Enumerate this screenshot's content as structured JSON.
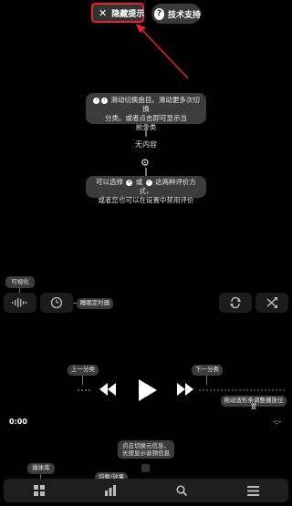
{
  "top": {
    "hide_tips_label": "隐藏提示",
    "support_label": "技术支持"
  },
  "tips": {
    "swipe_line1": "滑动切换曲目。滑动更多次切换",
    "swipe_line2": "分类。或者点击即可显示当",
    "swipe_line3": "前分类",
    "empty": "无内容",
    "rate_part1": "可以选择",
    "rate_or": "或",
    "rate_part2": "这两种评价方式，",
    "rate_line2": "或者您也可以在设置中禁用评价",
    "visualize": "可视化",
    "sleep_timer": "睡眠定时器",
    "prev_category": "上一分类",
    "next_category": "下一分类",
    "drag_waveform": "拖动波形条调整播放位置",
    "info_line1": "点击切换元信息，",
    "info_line2": "长按显示音频信息",
    "library": "媒体库",
    "equalizer": "均衡/效果"
  },
  "player": {
    "current_time": "0:00",
    "end_time": "-:-"
  },
  "icons": {
    "hide": "close-icon",
    "support": "help-icon",
    "settings": "gear-icon",
    "visualizer": "waveform-icon",
    "timer": "clock-icon",
    "repeat": "repeat-icon",
    "shuffle": "shuffle-icon",
    "play": "play-icon",
    "rewind": "rewind-icon",
    "fast_forward": "fast-forward-icon",
    "library": "grid-icon",
    "eq": "bars-icon",
    "search": "search-icon",
    "menu": "menu-icon"
  },
  "colors": {
    "highlight": "#e0262a",
    "background": "#000000",
    "tip_bg": "#3c3c3c"
  }
}
